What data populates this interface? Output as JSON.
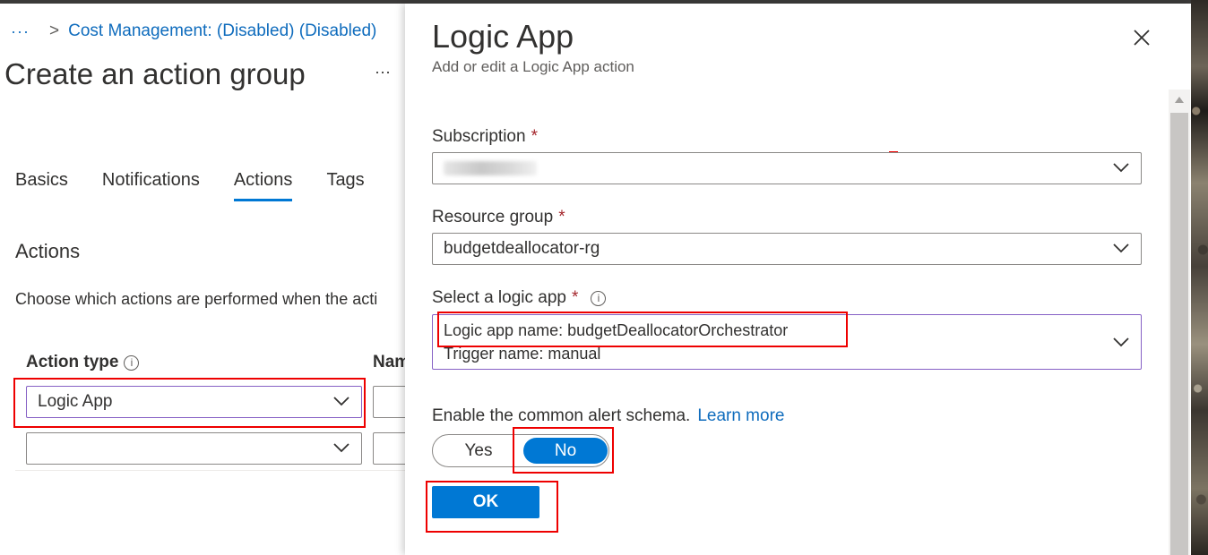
{
  "breadcrumb": {
    "more": "···",
    "item": "Cost Management: (Disabled) (Disabled)"
  },
  "page": {
    "title": "Create an action group",
    "more": "···"
  },
  "tabs": [
    {
      "label": "Basics",
      "active": false
    },
    {
      "label": "Notifications",
      "active": false
    },
    {
      "label": "Actions",
      "active": true
    },
    {
      "label": "Tags",
      "active": false
    }
  ],
  "actions_section": {
    "title": "Actions",
    "description": "Choose which actions are performed when the acti",
    "columns": {
      "action_type": "Action type",
      "name": "Nam"
    },
    "rows": [
      {
        "action_type": "Logic App"
      },
      {
        "action_type": ""
      }
    ]
  },
  "panel": {
    "title": "Logic App",
    "subtitle": "Add or edit a Logic App action",
    "subscription": {
      "label": "Subscription",
      "required": "*",
      "value": ""
    },
    "resource_group": {
      "label": "Resource group",
      "required": "*",
      "value": "budgetdeallocator-rg"
    },
    "logic_app": {
      "label": "Select a logic app",
      "required": "*",
      "line1": "Logic app name: budgetDeallocatorOrchestrator",
      "line2": "Trigger name: manual"
    },
    "schema": {
      "label": "Enable the common alert schema.",
      "link": "Learn more",
      "yes": "Yes",
      "no": "No",
      "selected": "No"
    },
    "ok_label": "OK"
  },
  "colors": {
    "accent": "#0078d4",
    "link": "#0f6cbd",
    "highlight": "#e00000",
    "required": "#a4262c",
    "focus_border": "#8661c5"
  },
  "icons": [
    "close-icon",
    "chevron-down-icon",
    "info-icon",
    "more-icon",
    "breadcrumb-chevron-icon"
  ]
}
